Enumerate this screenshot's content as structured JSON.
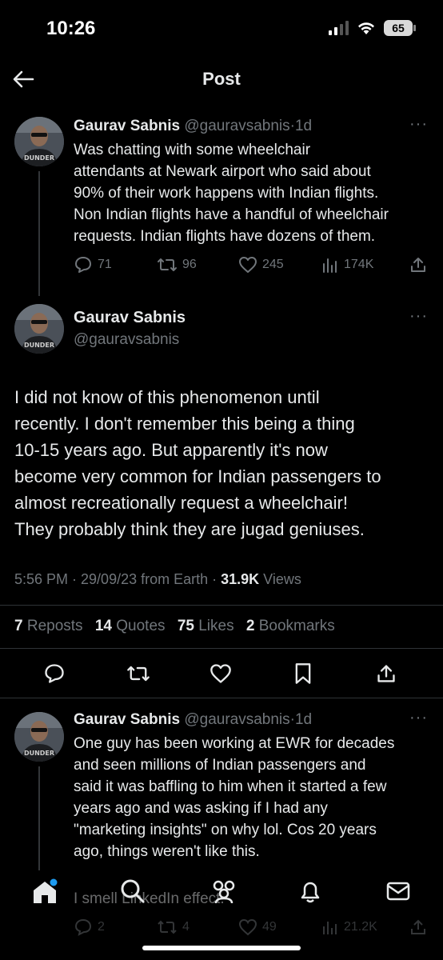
{
  "status_bar": {
    "time": "10:26",
    "battery": "65"
  },
  "header": {
    "title": "Post"
  },
  "tweet1": {
    "name": "Gaurav Sabnis",
    "handle": "@gauravsabnis",
    "dot": "·",
    "age": "1d",
    "lines": [
      "Was chatting with some wheelchair",
      "attendants at Newark airport who said about",
      "90% of their work happens with Indian flights.",
      "Non Indian flights have a handful of wheelchair",
      "requests. Indian flights have dozens of them."
    ],
    "replies": "71",
    "reposts": "96",
    "likes": "245",
    "views": "174K"
  },
  "main_tweet": {
    "name": "Gaurav Sabnis",
    "handle": "@gauravsabnis",
    "lines": [
      "I did not know of this phenomenon until",
      "recently. I don't remember this being a thing",
      "10-15 years ago. But apparently it's now",
      "become very common for Indian passengers to",
      "almost recreationally request a wheelchair!",
      "They probably think they are jugad geniuses."
    ],
    "meta_prefix": "5:56 PM · 29/09/23 from Earth · ",
    "views_count": "31.9K",
    "views_label": " Views",
    "reposts_count": "7",
    "reposts_label": "Reposts",
    "quotes_count": "14",
    "quotes_label": "Quotes",
    "likes_count": "75",
    "likes_label": "Likes",
    "bookmarks_count": "2",
    "bookmarks_label": "Bookmarks"
  },
  "tweet3": {
    "name": "Gaurav Sabnis",
    "handle": "@gauravsabnis",
    "dot": "·",
    "age": "1d",
    "lines": [
      "One guy has been working at EWR for decades",
      "and seen millions of Indian passengers and",
      "said it was baffling to him when it started a few",
      "years ago and was asking if I had any",
      "\"marketing insights\" on why lol. Cos 20 years",
      "ago, things weren't like this."
    ]
  },
  "tweet4": {
    "text": "I smell LinkedIn effect.",
    "replies": "2",
    "reposts": "4",
    "likes": "49",
    "views": "21.2K"
  },
  "colors": {
    "background": "#000000",
    "text": "#e7e9ea",
    "muted": "#71767b",
    "divider": "#2f3336",
    "accent_dot": "#1d9bf0"
  }
}
